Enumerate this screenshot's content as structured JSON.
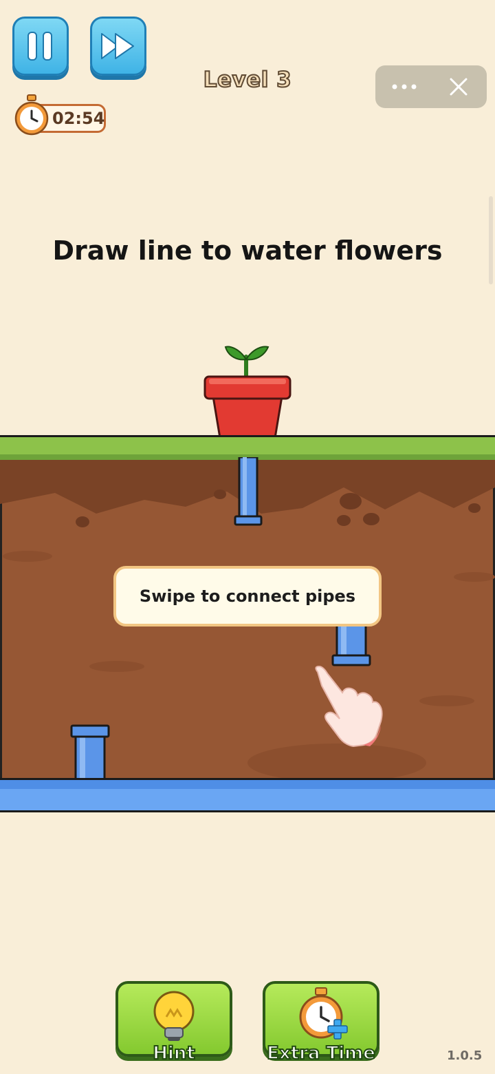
{
  "hud": {
    "pause_icon": "pause-icon",
    "skip_icon": "fast-forward-icon",
    "level_label": "Level 3",
    "timer": "02:54",
    "timer_icon": "stopwatch-icon",
    "menu_icon": "more-dots-icon",
    "close_icon": "close-icon"
  },
  "instruction": "Draw line to water flowers",
  "tooltip": "Swipe to connect pipes",
  "buttons": {
    "hint_label": "Hint",
    "hint_icon": "lightbulb-icon",
    "extra_time_label": "Extra Time",
    "extra_time_icon": "stopwatch-plus-icon"
  },
  "version": "1.0.5",
  "colors": {
    "background": "#f9eed8",
    "grass": "#8dc24a",
    "dirt": "#965734",
    "pipe": "#5b95e8",
    "pot": "#e23a32",
    "button_green": "#84c92f",
    "button_blue": "#3fb3e6"
  }
}
